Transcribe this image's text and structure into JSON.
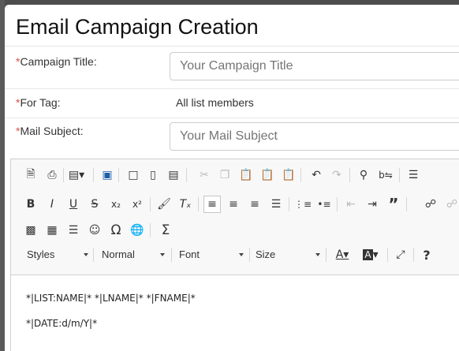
{
  "modal": {
    "title": "Email Campaign Creation"
  },
  "form": {
    "campaign_title": {
      "required_mark": "*",
      "label": "Campaign Title:",
      "placeholder": "Your Campaign Title"
    },
    "for_tag": {
      "required_mark": "*",
      "label": "For Tag:",
      "value": "All list members"
    },
    "mail_subject": {
      "required_mark": "*",
      "label": "Mail Subject:",
      "placeholder": "Your Mail Subject"
    }
  },
  "editor": {
    "toolbar": {
      "row1": [
        "preview-icon",
        "print-icon",
        "templates-icon",
        "save-icon",
        "new-page-icon",
        "blank-doc-icon",
        "paste-from-word-icon",
        "cut-icon",
        "copy-icon",
        "paste-icon",
        "paste-text-icon",
        "paste-word-icon",
        "undo-icon",
        "redo-icon",
        "find-icon",
        "replace-icon",
        "show-blocks-icon"
      ],
      "row2": [
        "bold-icon",
        "italic-icon",
        "underline-icon",
        "strikethrough-icon",
        "subscript-icon",
        "superscript-icon",
        "format-painter-icon",
        "remove-format-icon",
        "align-left-icon",
        "align-center-icon",
        "align-right-icon",
        "justify-icon",
        "numbered-list-icon",
        "bulleted-list-icon",
        "outdent-icon",
        "indent-icon",
        "blockquote-icon",
        "link-icon",
        "unlink-icon"
      ],
      "row3": [
        "image-icon",
        "table-icon",
        "horizontal-line-icon",
        "smiley-icon",
        "special-char-icon",
        "iframe-icon",
        "sum-icon"
      ],
      "styles_label": "Styles",
      "format_label": "Normal",
      "font_label": "Font",
      "size_label": "Size",
      "help_label": "?"
    },
    "content": {
      "line1": "*|LIST:NAME|* *|LNAME|* *|FNAME|*",
      "line2": "*|DATE:d/m/Y|*"
    }
  }
}
